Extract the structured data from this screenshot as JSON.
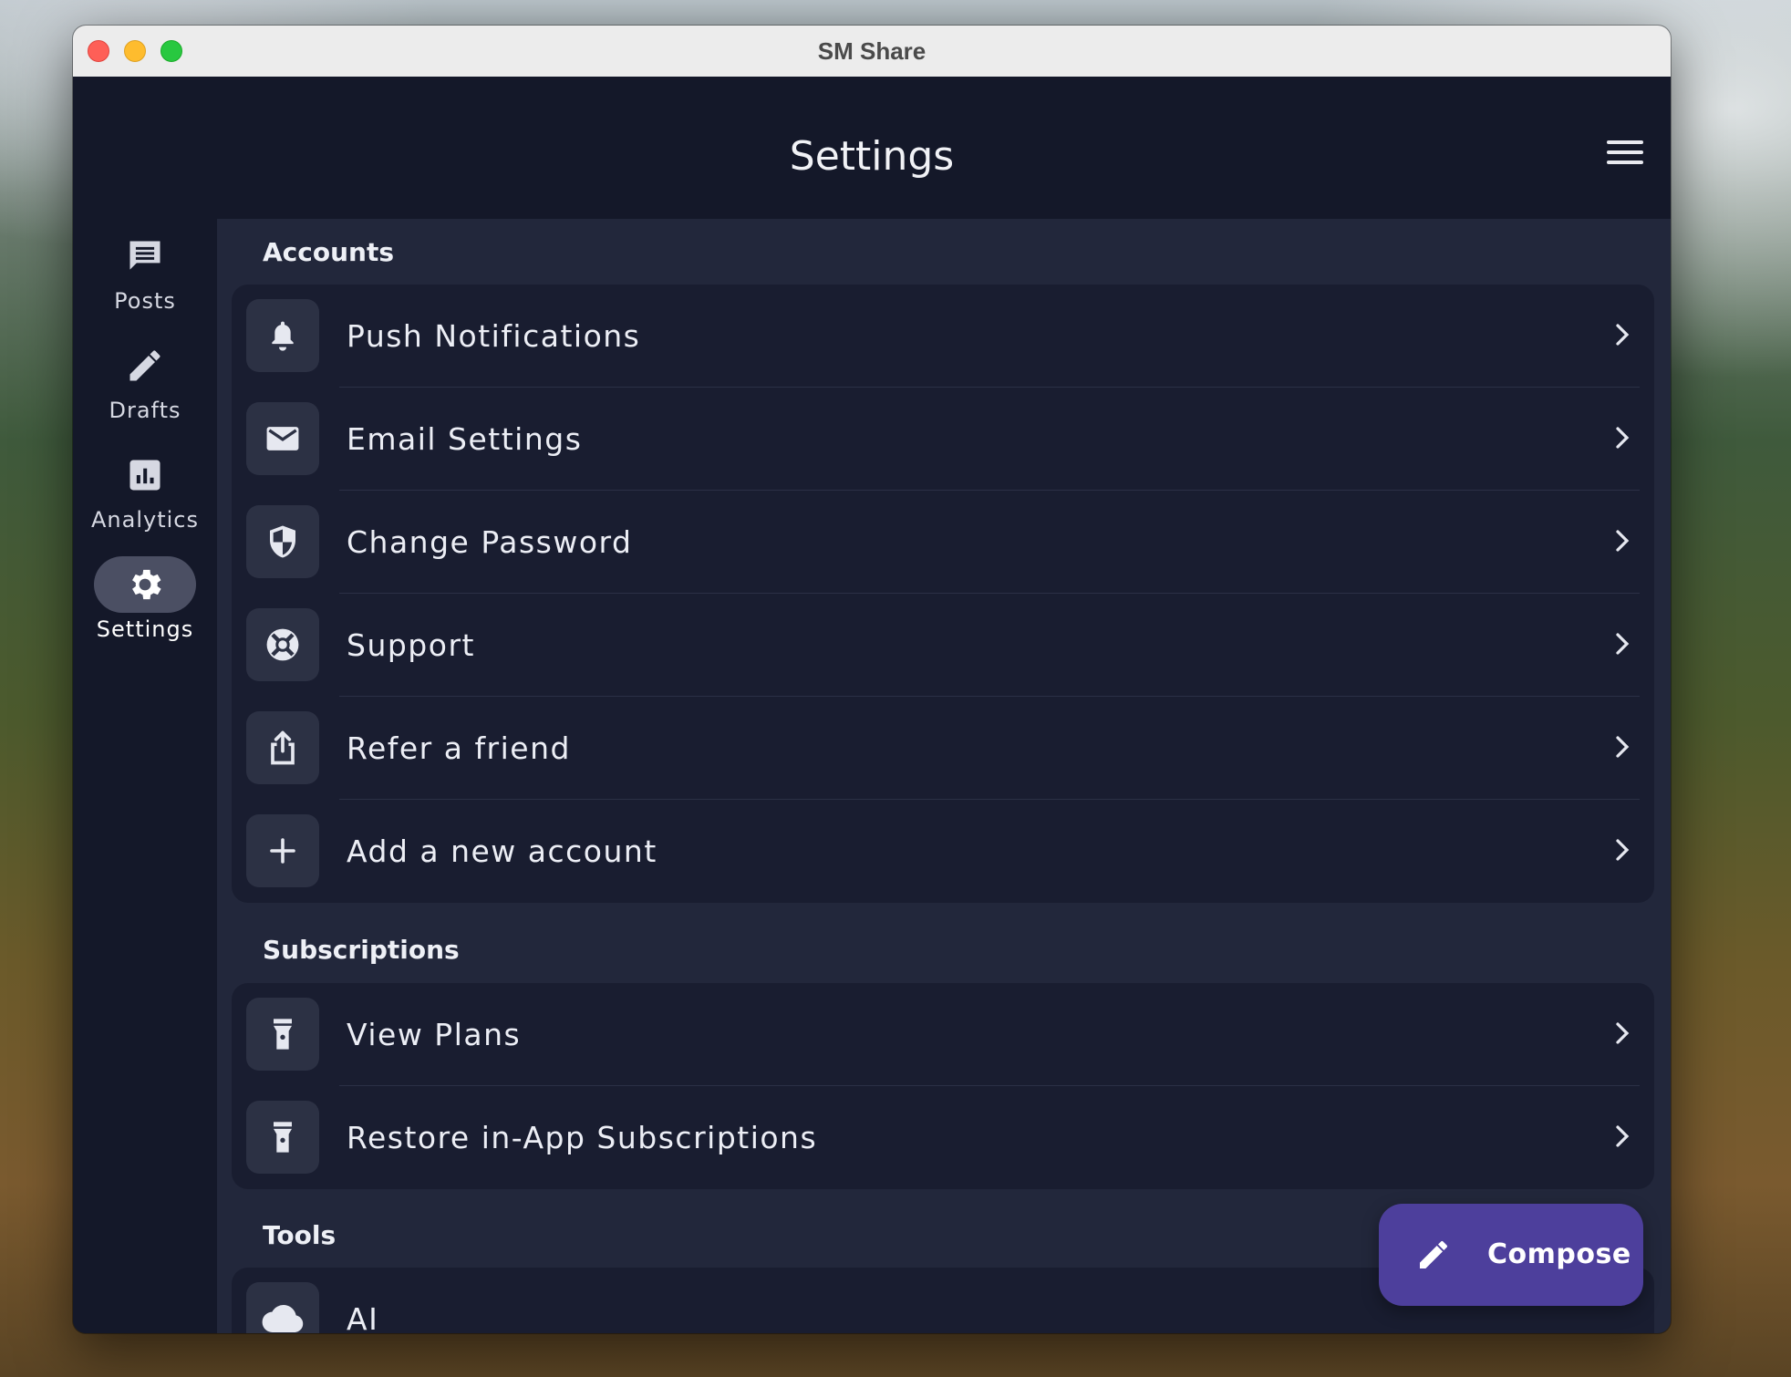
{
  "window": {
    "title": "SM Share"
  },
  "header": {
    "title": "Settings"
  },
  "sidebar": {
    "items": [
      {
        "label": "Posts",
        "icon": "message-icon"
      },
      {
        "label": "Drafts",
        "icon": "pencil-icon"
      },
      {
        "label": "Analytics",
        "icon": "chart-icon"
      },
      {
        "label": "Settings",
        "icon": "gear-icon",
        "active": true
      }
    ]
  },
  "sections": {
    "accounts": {
      "title": "Accounts",
      "rows": [
        {
          "label": "Push Notifications",
          "icon": "bell-icon"
        },
        {
          "label": "Email Settings",
          "icon": "envelope-icon"
        },
        {
          "label": "Change Password",
          "icon": "shield-icon"
        },
        {
          "label": "Support",
          "icon": "lifebuoy-icon"
        },
        {
          "label": "Refer a friend",
          "icon": "share-icon"
        },
        {
          "label": "Add a new account",
          "icon": "plus-icon"
        }
      ]
    },
    "subscriptions": {
      "title": "Subscriptions",
      "rows": [
        {
          "label": "View Plans",
          "icon": "flashlight-icon"
        },
        {
          "label": "Restore in-App Subscriptions",
          "icon": "flashlight-icon"
        }
      ]
    },
    "tools": {
      "title": "Tools",
      "rows": [
        {
          "label": "AI",
          "icon": "cloud-icon"
        }
      ]
    }
  },
  "compose": {
    "label": "Compose",
    "icon": "pencil-icon"
  },
  "colors": {
    "window_bg": "#161a2c",
    "content_bg": "#22273b",
    "card_bg": "#191d30",
    "icon_box": "#2c3144",
    "compose_bg": "#4d3f9c",
    "active_pill": "#4b4f63"
  }
}
